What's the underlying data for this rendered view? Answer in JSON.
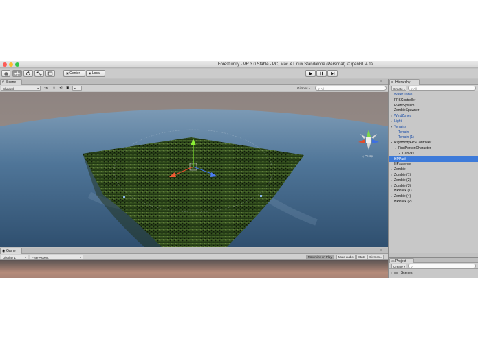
{
  "window": {
    "title": "Forest.unity - VR 3.0 Stable - PC, Mac & Linux Standalone (Personal) <OpenGL 4.1>"
  },
  "colors": {
    "close": "#fc5c57",
    "minimize": "#fdbb2e",
    "zoom": "#33c748",
    "selection": "#3d7ad9",
    "prefab_text": "#1c4fa8"
  },
  "toolbar": {
    "tools": [
      "hand-tool",
      "move-tool",
      "rotate-tool",
      "scale-tool",
      "rect-tool"
    ],
    "pivot_label": "Center",
    "space_label": "Local",
    "play_controls": [
      "play",
      "pause",
      "step"
    ]
  },
  "scene": {
    "tab_label": "Scene",
    "shading_mode": "Shaded",
    "mode_2d": "2D",
    "gizmos_label": "Gizmos",
    "search_placeholder": "All",
    "persp_label": "Persp"
  },
  "game": {
    "tab_label": "Game",
    "display": "Display 1",
    "aspect": "Free Aspect",
    "maximize_on_play": "Maximize on Play",
    "mute_audio": "Mute audio",
    "stats": "Stats",
    "gizmos": "Gizmos"
  },
  "hierarchy": {
    "tab_label": "Hierarchy",
    "create_label": "Create",
    "search_placeholder": "All",
    "items": [
      {
        "label": "Water Table",
        "indent": 0,
        "arrow": "",
        "style": "blue"
      },
      {
        "label": "FPSController",
        "indent": 0,
        "arrow": "",
        "style": "normal"
      },
      {
        "label": "EventSystem",
        "indent": 0,
        "arrow": "",
        "style": "normal"
      },
      {
        "label": "ZombieSpawner",
        "indent": 0,
        "arrow": "",
        "style": "normal"
      },
      {
        "label": "WindZones",
        "indent": 0,
        "arrow": "▸",
        "style": "blue"
      },
      {
        "label": "Light",
        "indent": 0,
        "arrow": "▸",
        "style": "blue"
      },
      {
        "label": "Terrains",
        "indent": 0,
        "arrow": "▾",
        "style": "blue"
      },
      {
        "label": "Terrain",
        "indent": 1,
        "arrow": "",
        "style": "blue"
      },
      {
        "label": "Terrain (1)",
        "indent": 1,
        "arrow": "",
        "style": "blue"
      },
      {
        "label": "RigidBodyFPSController",
        "indent": 0,
        "arrow": "▾",
        "style": "normal"
      },
      {
        "label": "FirstPersonCharacter",
        "indent": 1,
        "arrow": "▾",
        "style": "normal"
      },
      {
        "label": "Canvas",
        "indent": 2,
        "arrow": "▸",
        "style": "normal"
      },
      {
        "label": "HPPack",
        "indent": 0,
        "arrow": "",
        "style": "selected"
      },
      {
        "label": "HPspawner",
        "indent": 0,
        "arrow": "",
        "style": "normal"
      },
      {
        "label": "Zombie",
        "indent": 0,
        "arrow": "▸",
        "style": "normal"
      },
      {
        "label": "Zombie (1)",
        "indent": 0,
        "arrow": "▸",
        "style": "normal"
      },
      {
        "label": "Zombie (2)",
        "indent": 0,
        "arrow": "▸",
        "style": "normal"
      },
      {
        "label": "Zombie (3)",
        "indent": 0,
        "arrow": "▸",
        "style": "normal"
      },
      {
        "label": "HPPack (1)",
        "indent": 0,
        "arrow": "",
        "style": "normal"
      },
      {
        "label": "Zombie (4)",
        "indent": 0,
        "arrow": "▸",
        "style": "normal"
      },
      {
        "label": "HPPack (2)",
        "indent": 0,
        "arrow": "",
        "style": "normal"
      }
    ]
  },
  "project": {
    "tab_label": "Project",
    "create_label": "Create",
    "items": [
      {
        "label": "_Scenes",
        "arrow": "▸"
      }
    ]
  }
}
